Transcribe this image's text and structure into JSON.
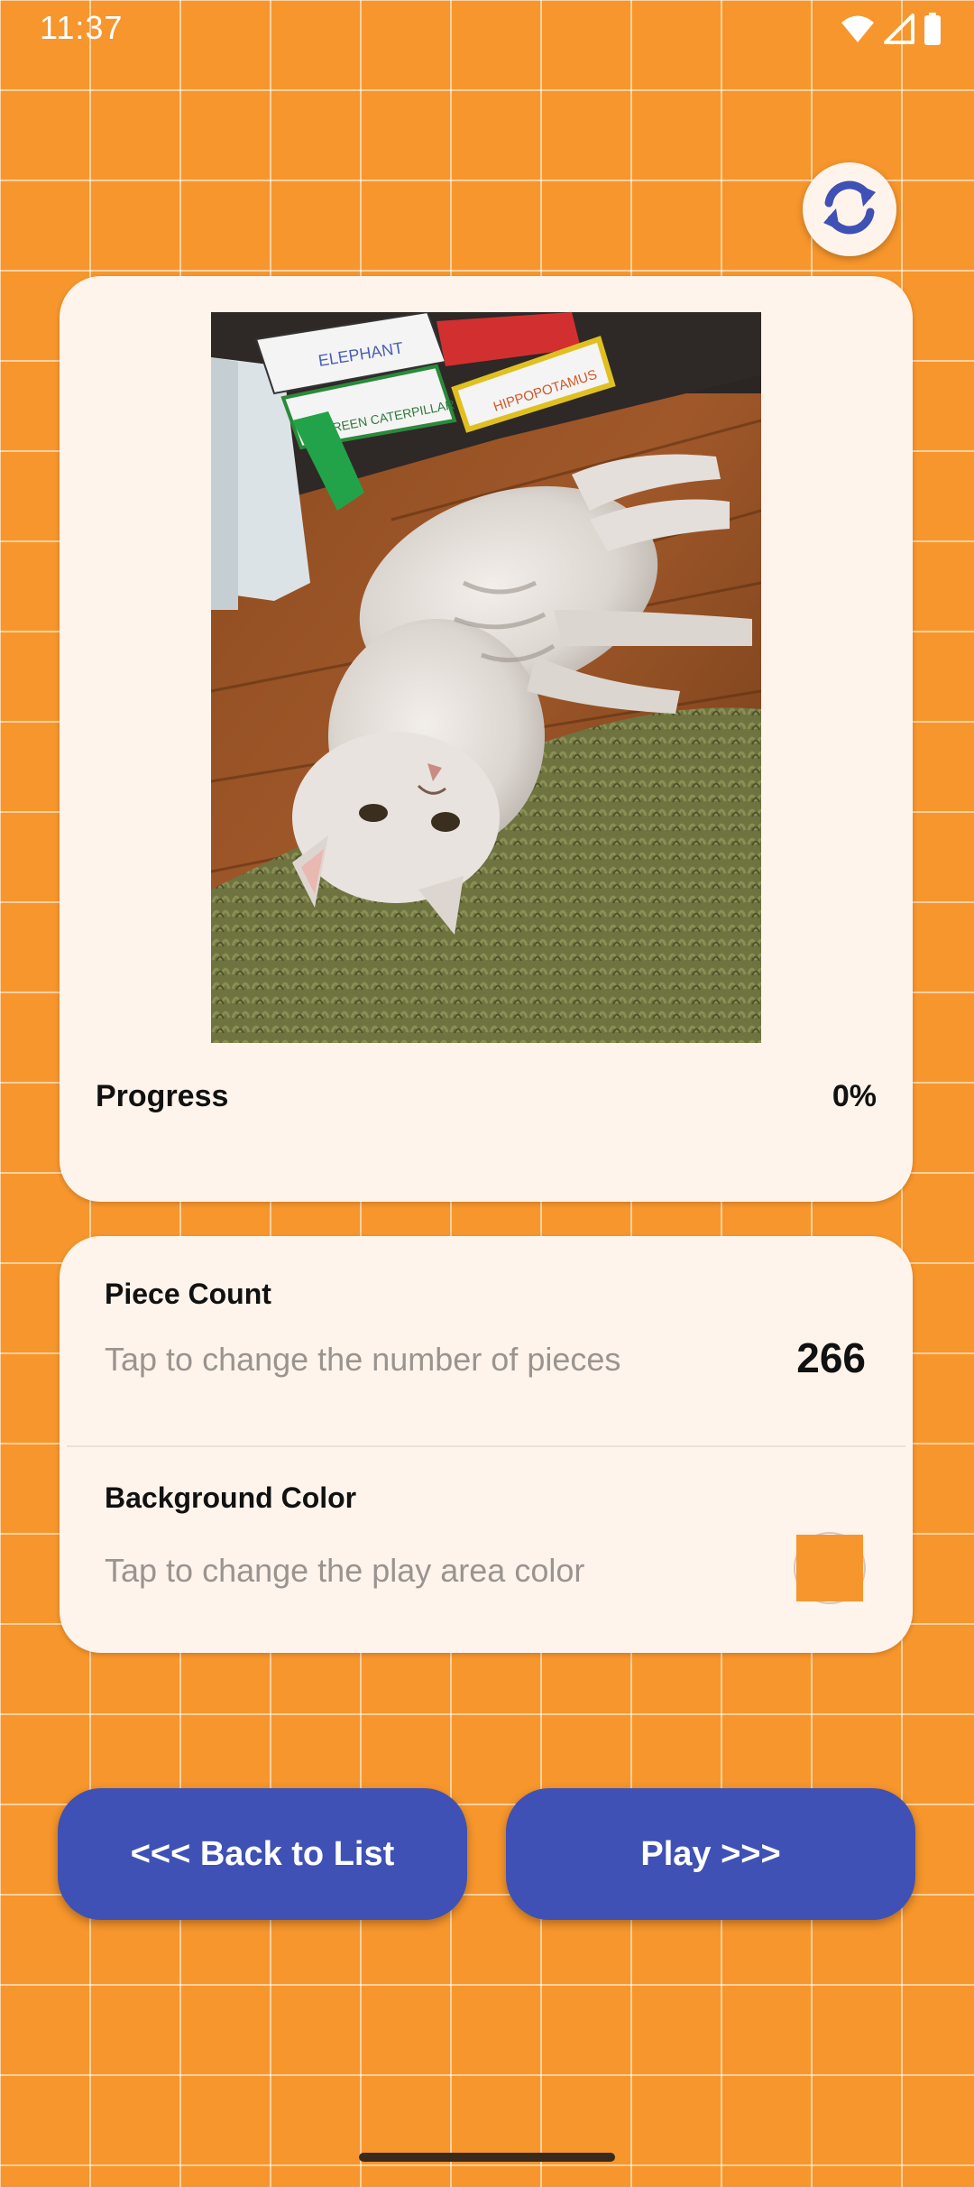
{
  "status_bar": {
    "time": "11:37",
    "icons": [
      "wifi-icon",
      "cellular-signal-icon",
      "battery-icon"
    ]
  },
  "refresh_button": {
    "icon": "refresh-icon",
    "icon_color": "#3F51B5"
  },
  "preview": {
    "image_subject": "photo of a white cat lying on a wooden floor next to a green rug and books",
    "book_labels": [
      "ELEPHANT",
      "GREEN CATERPILLAR",
      "HIPPOPOTAMUS"
    ],
    "progress_label": "Progress",
    "progress_value": "0%"
  },
  "settings": {
    "piece_count": {
      "title": "Piece Count",
      "description": "Tap to change the number of pieces",
      "value": "266"
    },
    "background_color": {
      "title": "Background Color",
      "description": "Tap to change the play area color",
      "swatch_color": "#F7962C"
    }
  },
  "actions": {
    "back_label": "<<< Back to List",
    "play_label": "Play >>>"
  },
  "colors": {
    "background": "#F7962C",
    "card": "#FFF4EC",
    "accent": "#3F51B5"
  }
}
